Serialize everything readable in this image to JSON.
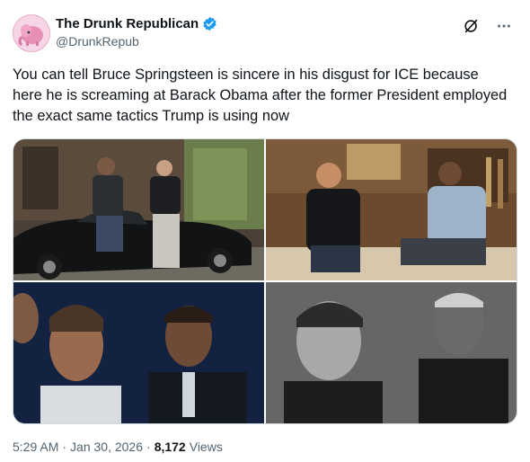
{
  "author": {
    "display_name": "The Drunk Republican",
    "handle": "@DrunkRepub",
    "verified": true
  },
  "icons": {
    "verified": "verified-badge-icon",
    "grok": "grok-icon",
    "more": "more-options-icon"
  },
  "tweet": {
    "text": "You can tell Bruce Springsteen is sincere in his disgust for ICE because here he is screaming at Barack Obama after the former President employed the exact same tactics Trump is using now"
  },
  "media": [
    {
      "description_name": "photo-1-car"
    },
    {
      "description_name": "photo-2-studio"
    },
    {
      "description_name": "photo-3-stage"
    },
    {
      "description_name": "photo-4-bw-portrait"
    }
  ],
  "meta": {
    "time": "5:29 AM",
    "date": "Jan 30, 2026",
    "separator": "·",
    "views_count": "8,172",
    "views_label": "Views"
  },
  "colors": {
    "verified_blue": "#1d9bf0",
    "secondary_text": "#536471",
    "primary_text": "#0f1419"
  }
}
